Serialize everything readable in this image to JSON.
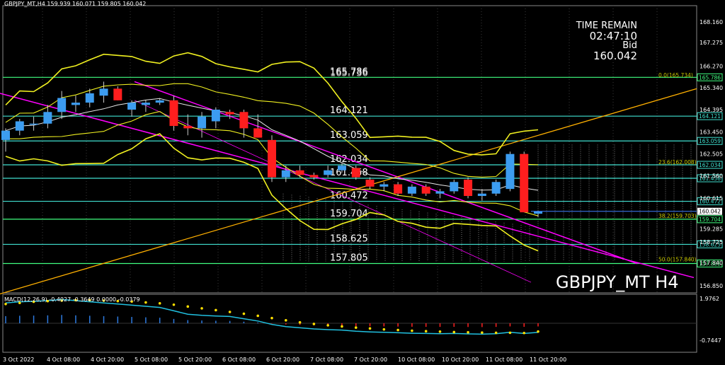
{
  "header": {
    "symbol_line": "GBPJPY_MT,H4  159.939 160.071 159.805 160.042",
    "macd_line": "MACD(12,26,9) -0.4027 -0.3649 0.0000 -0.0379"
  },
  "info": {
    "time_remain_label": "TIME REMAIN",
    "time_remain_value": "02:47:10",
    "bid_label": "Bid",
    "bid_value": "160.042"
  },
  "watermark": "GBPJPY_MT H4",
  "colors": {
    "background": "#000000",
    "bull": "#3c9cf0",
    "bear": "#ff1e1e",
    "bollinger": "#f0f020",
    "level_line": "#40e0d0",
    "channel": "#ff00ff",
    "trend": "#ffb000"
  },
  "price_axis": [
    "168.160",
    "167.275",
    "166.270",
    "165.340",
    "164.395",
    "163.450",
    "162.505",
    "161.560",
    "160.615",
    "159.285",
    "158.725",
    "157.840",
    "156.850"
  ],
  "price_axis_extra": [
    "161.458",
    "160.472",
    "159.704",
    "158.625",
    "157.805",
    "163.059",
    "162.034",
    "164.121",
    "165.786",
    "160.042"
  ],
  "macd_axis": [
    "1.9762",
    "-0.7447"
  ],
  "time_axis": [
    "3 Oct 2022",
    "4 Oct 08:00",
    "4 Oct 20:00",
    "5 Oct 08:00",
    "5 Oct 20:00",
    "6 Oct 08:00",
    "6 Oct 20:00",
    "7 Oct 08:00",
    "7 Oct 20:00",
    "10 Oct 08:00",
    "10 Oct 20:00",
    "11 Oct 08:00",
    "11 Oct 20:00"
  ],
  "levels": [
    {
      "label": "165.786",
      "value": 165.786
    },
    {
      "label": "164.121",
      "value": 164.121
    },
    {
      "label": "163.059",
      "value": 163.059
    },
    {
      "label": "162.034",
      "value": 162.034
    },
    {
      "label": "161.458",
      "value": 161.458
    },
    {
      "label": "160.472",
      "value": 160.472
    },
    {
      "label": "159.704",
      "value": 159.704
    },
    {
      "label": "158.625",
      "value": 158.625
    },
    {
      "label": "157.805",
      "value": 157.805
    }
  ],
  "level_overlap_label": "165.736",
  "fib_labels": [
    {
      "label": "0.0(165.734)",
      "value": 165.734
    },
    {
      "label": "23.6(162.008)",
      "value": 162.008
    },
    {
      "label": "38.2(159.703)",
      "value": 159.703
    },
    {
      "label": "50.0(157.840)",
      "value": 157.84
    }
  ],
  "chart_data": {
    "type": "candlestick",
    "candles": [
      {
        "o": 163.1,
        "h": 163.6,
        "l": 162.6,
        "c": 163.5
      },
      {
        "o": 163.5,
        "h": 164.0,
        "l": 163.3,
        "c": 163.9
      },
      {
        "o": 163.8,
        "h": 164.1,
        "l": 163.5,
        "c": 163.8
      },
      {
        "o": 163.8,
        "h": 164.6,
        "l": 163.6,
        "c": 164.3
      },
      {
        "o": 164.3,
        "h": 165.2,
        "l": 164.0,
        "c": 164.9
      },
      {
        "o": 164.6,
        "h": 165.0,
        "l": 164.3,
        "c": 164.7
      },
      {
        "o": 164.7,
        "h": 165.3,
        "l": 164.5,
        "c": 165.1
      },
      {
        "o": 165.0,
        "h": 165.6,
        "l": 164.7,
        "c": 165.3
      },
      {
        "o": 165.3,
        "h": 165.4,
        "l": 164.8,
        "c": 164.8
      },
      {
        "o": 164.4,
        "h": 164.8,
        "l": 164.1,
        "c": 164.7
      },
      {
        "o": 164.6,
        "h": 164.8,
        "l": 164.3,
        "c": 164.7
      },
      {
        "o": 164.7,
        "h": 164.9,
        "l": 164.6,
        "c": 164.8
      },
      {
        "o": 164.8,
        "h": 165.0,
        "l": 163.5,
        "c": 163.7
      },
      {
        "o": 163.7,
        "h": 164.2,
        "l": 163.3,
        "c": 163.6
      },
      {
        "o": 163.6,
        "h": 164.3,
        "l": 163.2,
        "c": 164.1
      },
      {
        "o": 163.9,
        "h": 164.5,
        "l": 163.6,
        "c": 164.4
      },
      {
        "o": 164.3,
        "h": 164.4,
        "l": 164.0,
        "c": 164.2
      },
      {
        "o": 164.3,
        "h": 164.4,
        "l": 163.2,
        "c": 163.6
      },
      {
        "o": 163.6,
        "h": 164.2,
        "l": 163.2,
        "c": 163.2
      },
      {
        "o": 163.1,
        "h": 163.3,
        "l": 161.3,
        "c": 161.5
      },
      {
        "o": 161.5,
        "h": 162.0,
        "l": 161.3,
        "c": 161.8
      },
      {
        "o": 161.8,
        "h": 162.0,
        "l": 161.5,
        "c": 161.6
      },
      {
        "o": 161.6,
        "h": 161.7,
        "l": 161.4,
        "c": 161.5
      },
      {
        "o": 161.6,
        "h": 162.0,
        "l": 161.5,
        "c": 161.8
      },
      {
        "o": 161.8,
        "h": 162.1,
        "l": 161.7,
        "c": 162.0
      },
      {
        "o": 161.9,
        "h": 162.0,
        "l": 161.4,
        "c": 161.5
      },
      {
        "o": 161.4,
        "h": 161.5,
        "l": 161.0,
        "c": 161.1
      },
      {
        "o": 161.1,
        "h": 161.3,
        "l": 160.9,
        "c": 161.2
      },
      {
        "o": 161.2,
        "h": 161.3,
        "l": 160.7,
        "c": 160.8
      },
      {
        "o": 160.8,
        "h": 161.2,
        "l": 160.7,
        "c": 161.1
      },
      {
        "o": 161.1,
        "h": 161.2,
        "l": 160.7,
        "c": 160.8
      },
      {
        "o": 160.8,
        "h": 161.0,
        "l": 160.6,
        "c": 160.9
      },
      {
        "o": 160.9,
        "h": 161.4,
        "l": 160.8,
        "c": 161.3
      },
      {
        "o": 161.4,
        "h": 161.5,
        "l": 160.6,
        "c": 160.7
      },
      {
        "o": 160.7,
        "h": 161.0,
        "l": 160.5,
        "c": 160.8
      },
      {
        "o": 160.8,
        "h": 161.4,
        "l": 160.7,
        "c": 161.3
      },
      {
        "o": 161.0,
        "h": 162.6,
        "l": 160.9,
        "c": 162.5
      },
      {
        "o": 162.5,
        "h": 162.6,
        "l": 160.0,
        "c": 160.0
      },
      {
        "o": 159.939,
        "h": 160.071,
        "l": 159.805,
        "c": 160.042
      }
    ],
    "macd": [
      0.9,
      0.95,
      0.97,
      1.0,
      1.05,
      1.0,
      0.95,
      0.9,
      0.85,
      0.8,
      0.75,
      0.7,
      0.55,
      0.4,
      0.35,
      0.32,
      0.3,
      0.2,
      0.1,
      -0.05,
      -0.15,
      -0.2,
      -0.25,
      -0.28,
      -0.3,
      -0.35,
      -0.38,
      -0.4,
      -0.42,
      -0.44,
      -0.45,
      -0.46,
      -0.45,
      -0.47,
      -0.48,
      -0.46,
      -0.4,
      -0.45,
      -0.4027
    ],
    "signal": [
      0.85,
      0.9,
      0.95,
      0.98,
      1.0,
      1.02,
      1.02,
      1.0,
      0.98,
      0.96,
      0.92,
      0.88,
      0.82,
      0.74,
      0.66,
      0.58,
      0.5,
      0.42,
      0.33,
      0.23,
      0.13,
      0.04,
      -0.03,
      -0.09,
      -0.14,
      -0.19,
      -0.23,
      -0.27,
      -0.3,
      -0.33,
      -0.35,
      -0.37,
      -0.39,
      -0.4,
      -0.41,
      -0.42,
      -0.42,
      -0.43,
      -0.3649
    ],
    "ylim": [
      156.5,
      168.5
    ]
  }
}
